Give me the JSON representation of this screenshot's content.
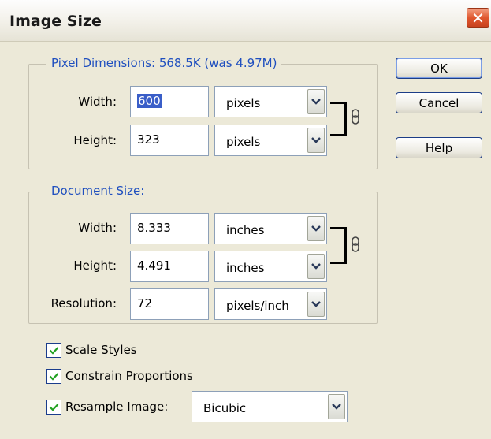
{
  "dialog": {
    "title": "Image Size",
    "close_icon": "close-x-icon"
  },
  "pixel_dimensions": {
    "legend": "Pixel Dimensions:  568.5K (was 4.97M)",
    "width_label": "Width:",
    "width_value": "600",
    "width_unit": "pixels",
    "height_label": "Height:",
    "height_value": "323",
    "height_unit": "pixels",
    "link_icon": "chain-link-icon"
  },
  "document_size": {
    "legend": "Document Size:",
    "width_label": "Width:",
    "width_value": "8.333",
    "width_unit": "inches",
    "height_label": "Height:",
    "height_value": "4.491",
    "height_unit": "inches",
    "resolution_label": "Resolution:",
    "resolution_value": "72",
    "resolution_unit": "pixels/inch",
    "link_icon": "chain-link-icon"
  },
  "buttons": {
    "ok": "OK",
    "cancel": "Cancel",
    "help": "Help"
  },
  "options": {
    "scale_styles": {
      "label": "Scale Styles",
      "checked": true
    },
    "constrain_proportions": {
      "label": "Constrain Proportions",
      "checked": true
    },
    "resample_image": {
      "label": "Resample Image:",
      "checked": true,
      "method": "Bicubic"
    }
  },
  "colors": {
    "legend_text": "#1f4fbf",
    "dialog_bg": "#ece9d8",
    "close_button": "#e0582f"
  }
}
